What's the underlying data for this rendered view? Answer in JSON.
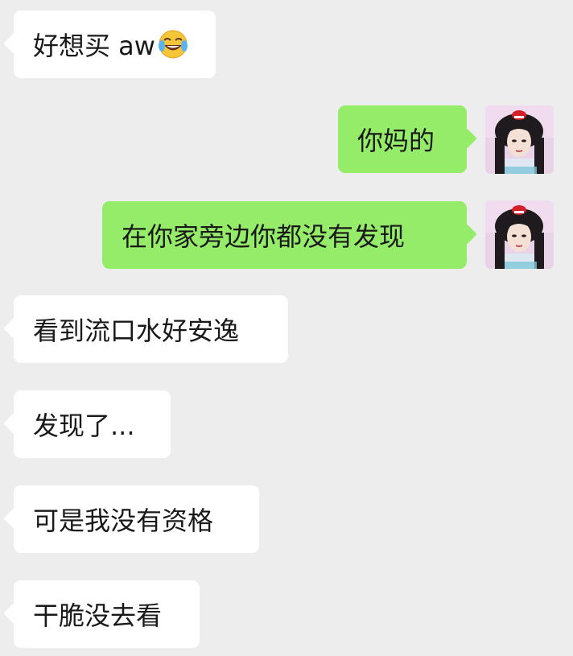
{
  "messages": [
    {
      "side": "in",
      "text": "好想买 aw",
      "emoji": "laugh-cry-icon"
    },
    {
      "side": "out",
      "text": "你妈的",
      "avatar": "user-avatar"
    },
    {
      "side": "out",
      "text": "在你家旁边你都没有发现",
      "avatar": "user-avatar"
    },
    {
      "side": "in",
      "text": "看到流口水好安逸"
    },
    {
      "side": "in",
      "text": "发现了..."
    },
    {
      "side": "in",
      "text": "可是我没有资格"
    },
    {
      "side": "in",
      "text": "干脆没去看"
    }
  ],
  "colors": {
    "background": "#ededed",
    "incoming_bubble": "#ffffff",
    "outgoing_bubble": "#95ec69",
    "text": "#191919"
  }
}
